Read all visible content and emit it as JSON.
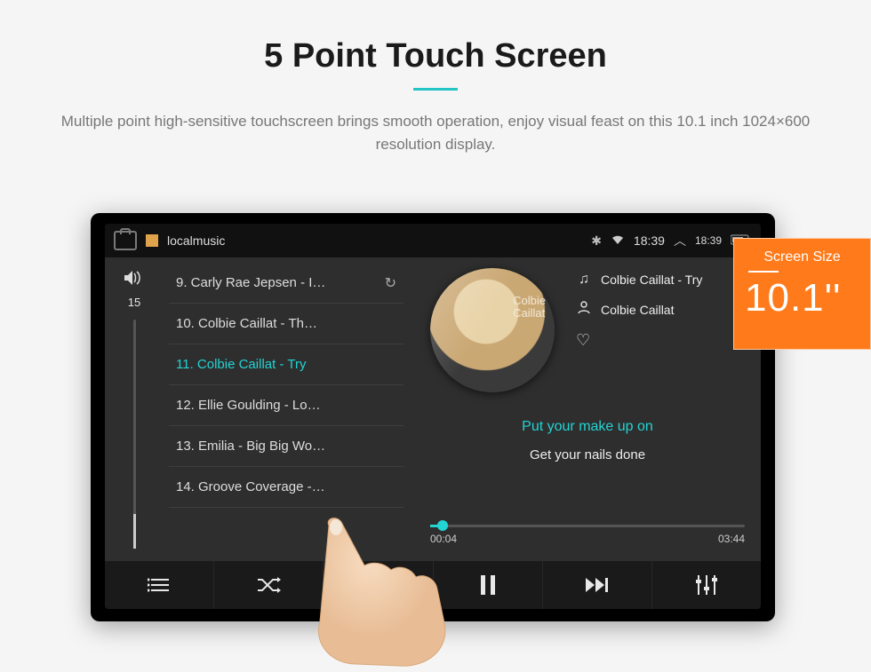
{
  "hero": {
    "title": "5 Point Touch Screen",
    "subtitle": "Multiple point high-sensitive touchscreen brings smooth operation, enjoy visual feast on this 10.1 inch 1024×600 resolution display."
  },
  "overlay": {
    "title": "Screen Size",
    "value": "10.1''"
  },
  "statusbar": {
    "app_label": "localmusic",
    "time_primary": "18:39",
    "time_secondary": "18:39"
  },
  "volume": {
    "level": "15"
  },
  "playlist": {
    "items": [
      {
        "label": "9. Carly Rae Jepsen - I…",
        "selected": false,
        "has_loop": true
      },
      {
        "label": "10. Colbie Caillat - Th…",
        "selected": false,
        "has_loop": false
      },
      {
        "label": "11. Colbie Caillat - Try",
        "selected": true,
        "has_loop": false
      },
      {
        "label": "12. Ellie Goulding - Lo…",
        "selected": false,
        "has_loop": false
      },
      {
        "label": "13. Emilia - Big Big Wo…",
        "selected": false,
        "has_loop": false
      },
      {
        "label": "14. Groove Coverage -…",
        "selected": false,
        "has_loop": false
      }
    ]
  },
  "nowplaying": {
    "album_text_line1": "Colbie",
    "album_text_line2": "Caillat",
    "track_title": "Colbie Caillat - Try",
    "artist": "Colbie Caillat",
    "lyric_current": "Put your make up on",
    "lyric_next": "Get your nails done",
    "elapsed": "00:04",
    "total": "03:44"
  },
  "icons": {
    "bluetooth": "✱",
    "wifi": "▲",
    "chevron": "︿",
    "battery": "▭",
    "speaker": "🔊",
    "loop": "↻",
    "note": "♫",
    "person": "👤",
    "heart": "♡",
    "list": "≣",
    "shuffle": "✕",
    "prev": "⏮",
    "pause": "⏸",
    "next": "⏭",
    "eq": "⚍"
  }
}
